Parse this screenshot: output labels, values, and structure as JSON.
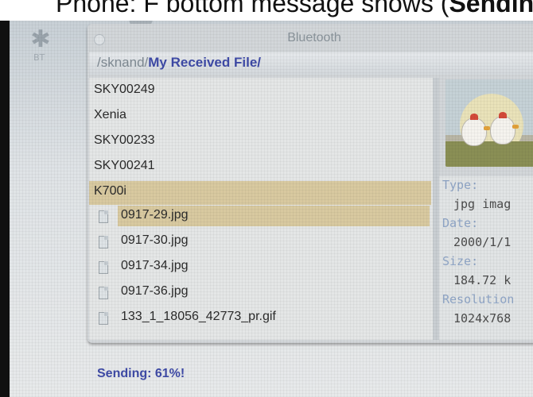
{
  "caption": {
    "prefix": "Phone: F bottom message shows (",
    "bold": "Sendin"
  },
  "side": {
    "bt_icon": "bluetooth-icon",
    "bt_label": "BT"
  },
  "window": {
    "title": "Bluetooth",
    "path_prefix": "/sknand/",
    "path_main": "My Received File/"
  },
  "file_list": {
    "folders": [
      "SKY00249",
      "Xenia",
      "SKY00233",
      "SKY00241",
      "K700i"
    ],
    "selected_folder": "K700i",
    "files": [
      "0917-29.jpg",
      "0917-30.jpg",
      "0917-34.jpg",
      "0917-36.jpg",
      "133_1_18056_42773_pr.gif"
    ],
    "selected_file": "0917-29.jpg"
  },
  "details": {
    "type_label": "Type:",
    "type_value": "jpg imag",
    "date_label": "Date:",
    "date_value": "2000/1/1",
    "size_label": "Size:",
    "size_value": "184.72 k",
    "resolution_label": "Resolution",
    "resolution_value": "1024x768"
  },
  "status": {
    "text": "Sending: 61%!",
    "progress_percent": 61
  },
  "colors": {
    "accent": "#3e4aa6",
    "selection": "#d8c9a0"
  }
}
